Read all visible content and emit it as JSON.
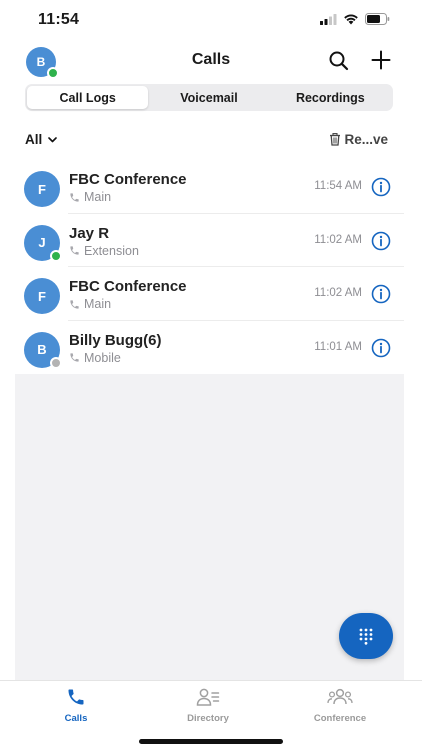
{
  "status_bar": {
    "time": "11:54"
  },
  "header": {
    "avatar_initial": "B",
    "title": "Calls"
  },
  "tabs": [
    {
      "label": "Call Logs",
      "active": true
    },
    {
      "label": "Voicemail",
      "active": false
    },
    {
      "label": "Recordings",
      "active": false
    }
  ],
  "filter": {
    "selected": "All",
    "remove_label": "Re...ve"
  },
  "calls": [
    {
      "initial": "F",
      "name": "FBC Conference",
      "line": "Main",
      "time": "11:54 AM",
      "presence": "none"
    },
    {
      "initial": "J",
      "name": "Jay R",
      "line": "Extension",
      "time": "11:02 AM",
      "presence": "available"
    },
    {
      "initial": "F",
      "name": "FBC Conference",
      "line": "Main",
      "time": "11:02 AM",
      "presence": "none"
    },
    {
      "initial": "B",
      "name": "Billy Bugg(6)",
      "line": "Mobile",
      "time": "11:01 AM",
      "presence": "offline"
    }
  ],
  "bottom_nav": [
    {
      "label": "Calls",
      "icon": "phone-icon",
      "active": true
    },
    {
      "label": "Directory",
      "icon": "contacts-icon",
      "active": false
    },
    {
      "label": "Conference",
      "icon": "group-icon",
      "active": false
    }
  ],
  "colors": {
    "accent": "#1565c0",
    "avatar": "#4a8ed4",
    "presence_available": "#2fb24c",
    "presence_offline": "#b3b3b3"
  }
}
